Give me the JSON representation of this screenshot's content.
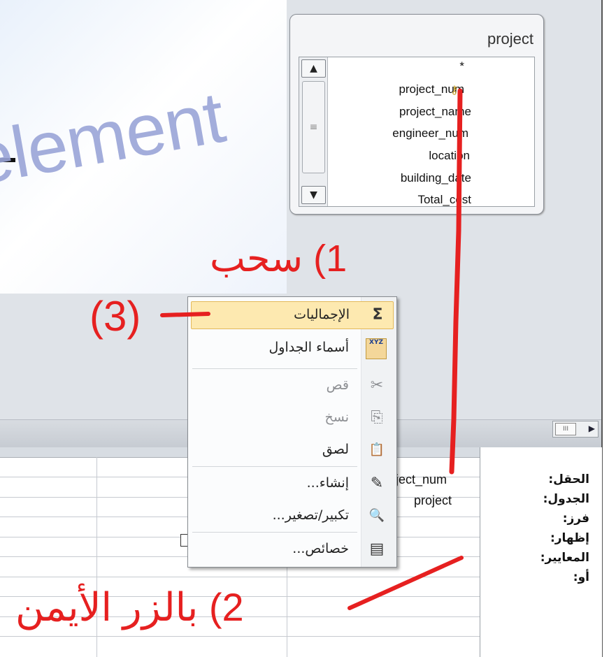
{
  "watermark": "element",
  "table": {
    "title": "project",
    "fields": [
      "*",
      "project_num",
      "project_name",
      "engineer_num",
      "location",
      "building_date",
      "Total_cost"
    ],
    "key_field": "project_num"
  },
  "scrollbar": {
    "up_arrow": "▲",
    "down_arrow": "▼",
    "grip": "≡",
    "h_grip": "III",
    "h_arrow": "▶"
  },
  "grid": {
    "row_labels": [
      "الحقل:",
      "الجدول:",
      "فرز:",
      "إظهار:",
      "المعايير:",
      "أو:"
    ],
    "field_value": "ject_num",
    "table_value": "project"
  },
  "context_menu": {
    "items": [
      {
        "label": "الإجماليات",
        "icon": "sigma-icon",
        "glyph": "Σ",
        "enabled": true
      },
      {
        "label": "أسماء الجداول",
        "icon": "table-names-icon",
        "glyph": "XYZ",
        "enabled": true
      },
      {
        "label": "قص",
        "icon": "cut-icon",
        "glyph": "✂",
        "enabled": false
      },
      {
        "label": "نسخ",
        "icon": "copy-icon",
        "glyph": "⎘",
        "enabled": false
      },
      {
        "label": "لصق",
        "icon": "paste-icon",
        "glyph": "📋",
        "enabled": true
      },
      {
        "label": "إنشاء...",
        "icon": "build-icon",
        "glyph": "✎",
        "enabled": true
      },
      {
        "label": "تكبير/تصغير...",
        "icon": "zoom-icon",
        "glyph": "🔍",
        "enabled": true
      },
      {
        "label": "خصائص...",
        "icon": "properties-icon",
        "glyph": "▤",
        "enabled": true
      }
    ]
  },
  "annotations": {
    "step1": "1) سحب",
    "step2": "2) بالزر الأيمن",
    "step3": "(3)"
  },
  "colors": {
    "annotation": "#e62020",
    "highlight": "#fde9b0",
    "watermark": "#9aa5d8"
  }
}
